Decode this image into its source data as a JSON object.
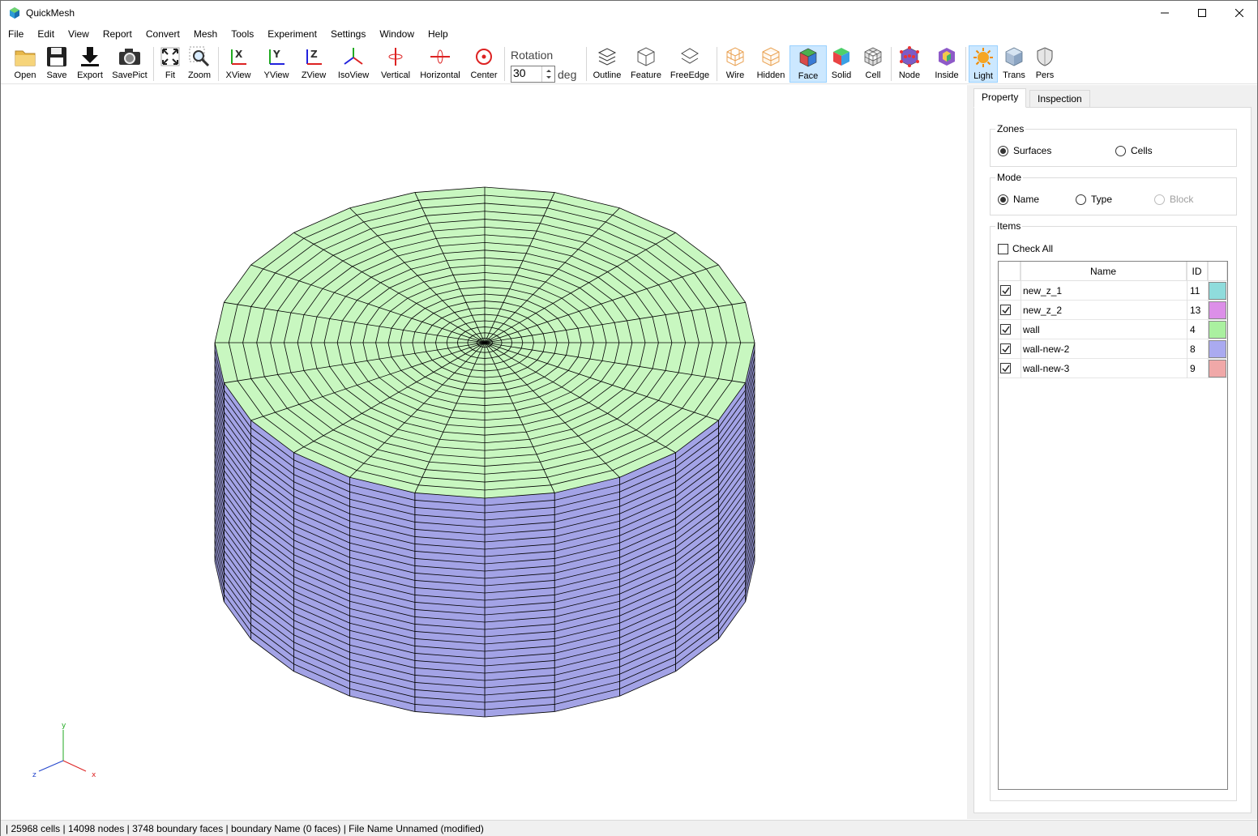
{
  "app": {
    "title": "QuickMesh"
  },
  "menu": [
    "File",
    "Edit",
    "View",
    "Report",
    "Convert",
    "Mesh",
    "Tools",
    "Experiment",
    "Settings",
    "Window",
    "Help"
  ],
  "toolbar": {
    "open": "Open",
    "save": "Save",
    "export": "Export",
    "savepict": "SavePict",
    "fit": "Fit",
    "zoom": "Zoom",
    "xview": "XView",
    "yview": "YView",
    "zview": "ZView",
    "isoview": "IsoView",
    "vertical": "Vertical",
    "horizontal": "Horizontal",
    "center": "Center",
    "rotation_label": "Rotation",
    "rotation_value": "30",
    "rotation_unit": "deg",
    "outline": "Outline",
    "feature": "Feature",
    "freeedge": "FreeEdge",
    "wire": "Wire",
    "hidden": "Hidden",
    "face": "Face",
    "solid": "Solid",
    "cell": "Cell",
    "node": "Node",
    "inside": "Inside",
    "light": "Light",
    "trans": "Trans",
    "pers": "Pers",
    "active": [
      "Face",
      "Light"
    ]
  },
  "panel": {
    "tabs": [
      "Property",
      "Inspection"
    ],
    "active_tab": "Property",
    "zones": {
      "title": "Zones",
      "options": [
        "Surfaces",
        "Cells"
      ],
      "selected": "Surfaces"
    },
    "mode": {
      "title": "Mode",
      "options": [
        "Name",
        "Type",
        "Block"
      ],
      "selected": "Name",
      "disabled": [
        "Block"
      ]
    },
    "items": {
      "title": "Items",
      "check_all": "Check All",
      "columns": [
        "Name",
        "ID"
      ],
      "rows": [
        {
          "name": "new_z_1",
          "id": "11",
          "color": "#8fdcdc",
          "checked": true
        },
        {
          "name": "new_z_2",
          "id": "13",
          "color": "#dc8fe8",
          "checked": true
        },
        {
          "name": "wall",
          "id": "4",
          "color": "#aaf0a0",
          "checked": true
        },
        {
          "name": "wall-new-2",
          "id": "8",
          "color": "#aaaaf0",
          "checked": true
        },
        {
          "name": "wall-new-3",
          "id": "9",
          "color": "#f0a8a8",
          "checked": true
        }
      ]
    }
  },
  "axes": {
    "x": "x",
    "y": "y",
    "z": "z"
  },
  "mesh_colors": {
    "top": "#c8f7c0",
    "side": "#a3a3e6",
    "line": "#000000"
  },
  "status": "| 25968 cells | 14098 nodes | 3748 boundary faces |  boundary Name  (0 faces) | File Name Unnamed (modified)"
}
